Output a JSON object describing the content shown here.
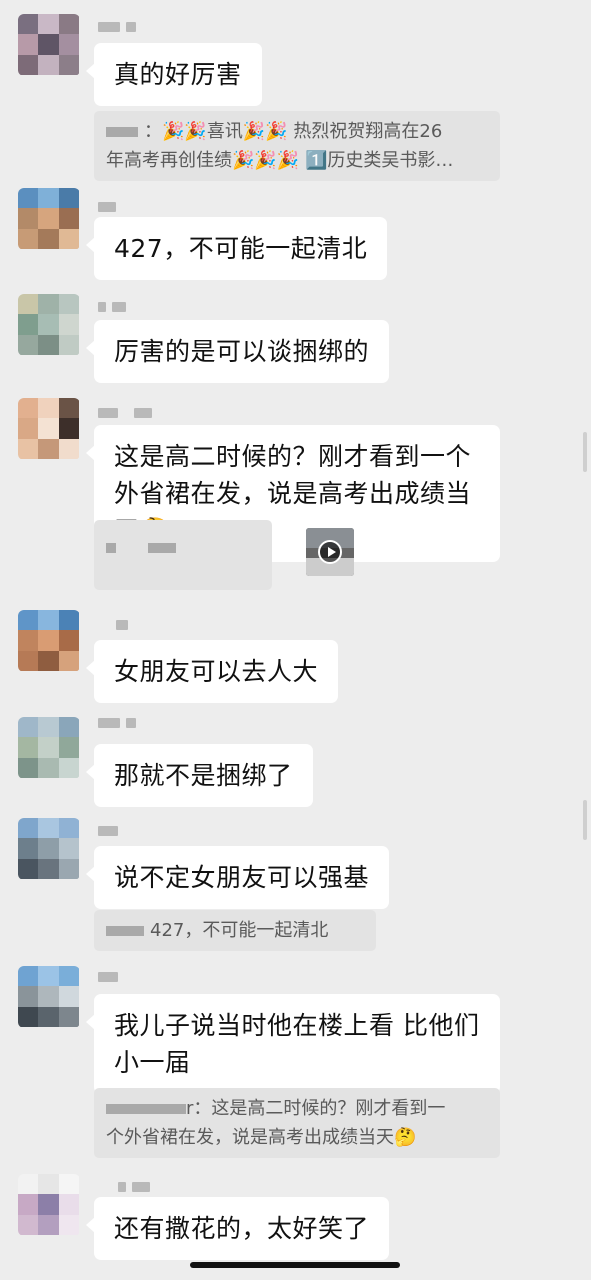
{
  "messages": [
    {
      "text": "真的好厉害"
    },
    {
      "text": "427，不可能一起清北"
    },
    {
      "text": "厉害的是可以谈捆绑的"
    },
    {
      "text": "这是高二时候的？刚才看到一个外省裙在发，说是高考出成绩当天🤔"
    },
    {
      "text": "女朋友可以去人大"
    },
    {
      "text": "那就不是捆绑了"
    },
    {
      "text": "说不定女朋友可以强基"
    },
    {
      "text": "我儿子说当时他在楼上看 比他们小一届"
    },
    {
      "text": "还有撒花的，太好笑了"
    }
  ],
  "quotes": {
    "q1_line1": "：🎉🎉喜讯🎉🎉 热烈祝贺翔高在26",
    "q1_line2": "年高考再创佳绩🎉🎉🎉 1️⃣历史类吴书影…",
    "q2": "427，不可能一起清北",
    "q3_line1": "r：这是高二时候的？刚才看到一",
    "q3_line2": "个外省裙在发，说是高考出成绩当天🤔"
  },
  "colors": {
    "background": "#ededed",
    "bubble": "#ffffff",
    "quote_bg": "#e3e3e3"
  },
  "icons": [
    "play-icon"
  ]
}
